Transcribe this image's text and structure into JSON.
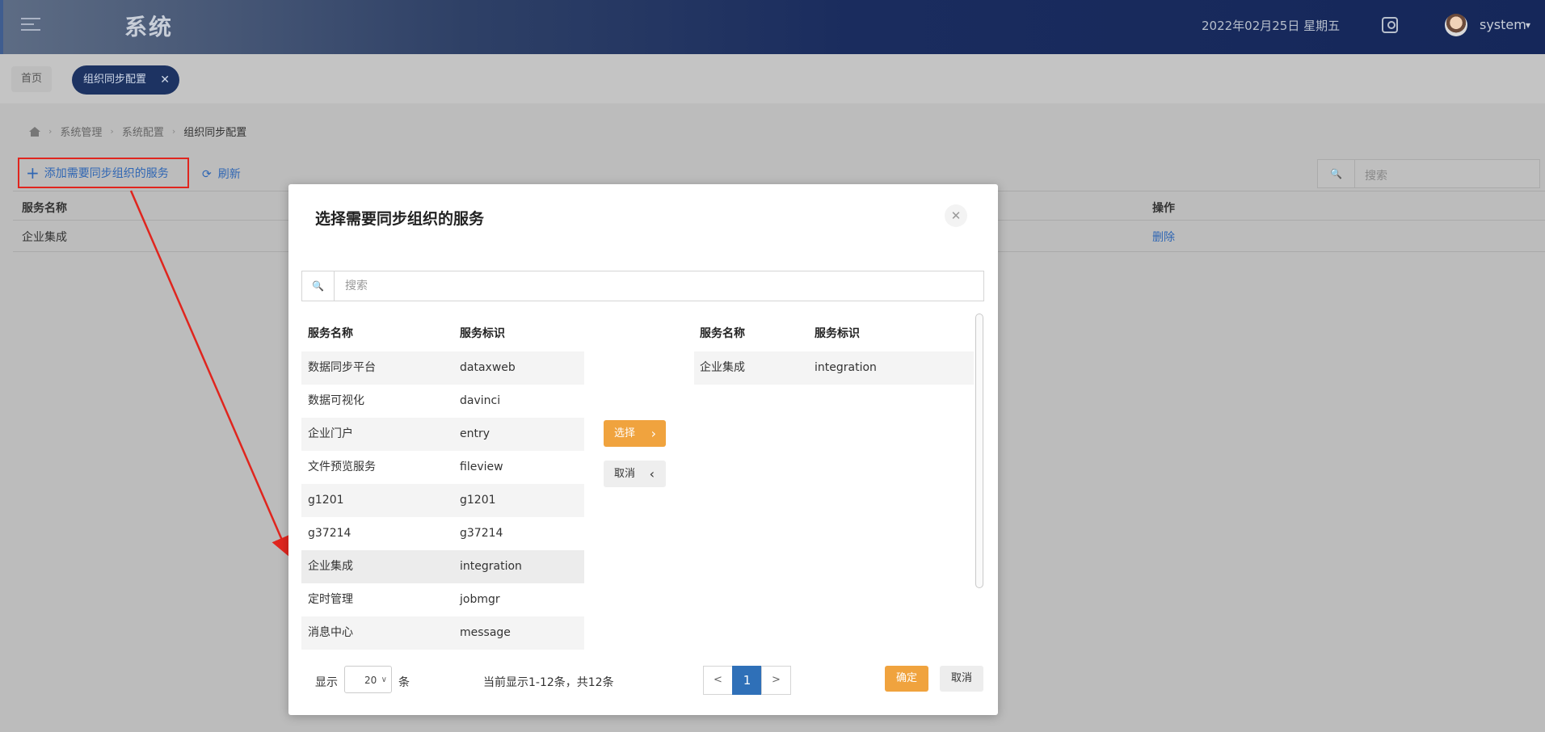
{
  "header": {
    "app_title": "系统",
    "date": "2022年02月25日 星期五",
    "username": "system"
  },
  "tabs": {
    "home": "首页",
    "active": "组织同步配置"
  },
  "breadcrumb": [
    "系统管理",
    "系统配置",
    "组织同步配置"
  ],
  "toolbar": {
    "add_label": "添加需要同步组织的服务",
    "refresh_label": "刷新",
    "search_placeholder": "搜索"
  },
  "main_table": {
    "columns": [
      "服务名称",
      "操作"
    ],
    "rows": [
      {
        "name": "企业集成",
        "action": "删除"
      }
    ]
  },
  "modal": {
    "title": "选择需要同步组织的服务",
    "search_placeholder": "搜索",
    "left_columns": [
      "服务名称",
      "服务标识"
    ],
    "left_rows": [
      {
        "name": "数据同步平台",
        "id": "dataxweb"
      },
      {
        "name": "数据可视化",
        "id": "davinci"
      },
      {
        "name": "企业门户",
        "id": "entry"
      },
      {
        "name": "文件预览服务",
        "id": "fileview"
      },
      {
        "name": "g1201",
        "id": "g1201"
      },
      {
        "name": "g37214",
        "id": "g37214"
      },
      {
        "name": "企业集成",
        "id": "integration"
      },
      {
        "name": "定时管理",
        "id": "jobmgr"
      },
      {
        "name": "消息中心",
        "id": "message"
      }
    ],
    "select_label": "选择",
    "cancel_move_label": "取消",
    "right_columns": [
      "服务名称",
      "服务标识"
    ],
    "right_rows": [
      {
        "name": "企业集成",
        "id": "integration"
      }
    ],
    "footer": {
      "show_label": "显示",
      "page_size": "20",
      "unit_label": "条",
      "info": "当前显示1-12条，共12条",
      "prev": "<",
      "current_page": "1",
      "next": ">",
      "ok_label": "确定",
      "cancel_label": "取消"
    }
  },
  "colors": {
    "accent_orange": "#f0a33e",
    "link_blue": "#2f66b3",
    "header_navy": "#15275a",
    "annotation_red": "#e0251e"
  }
}
